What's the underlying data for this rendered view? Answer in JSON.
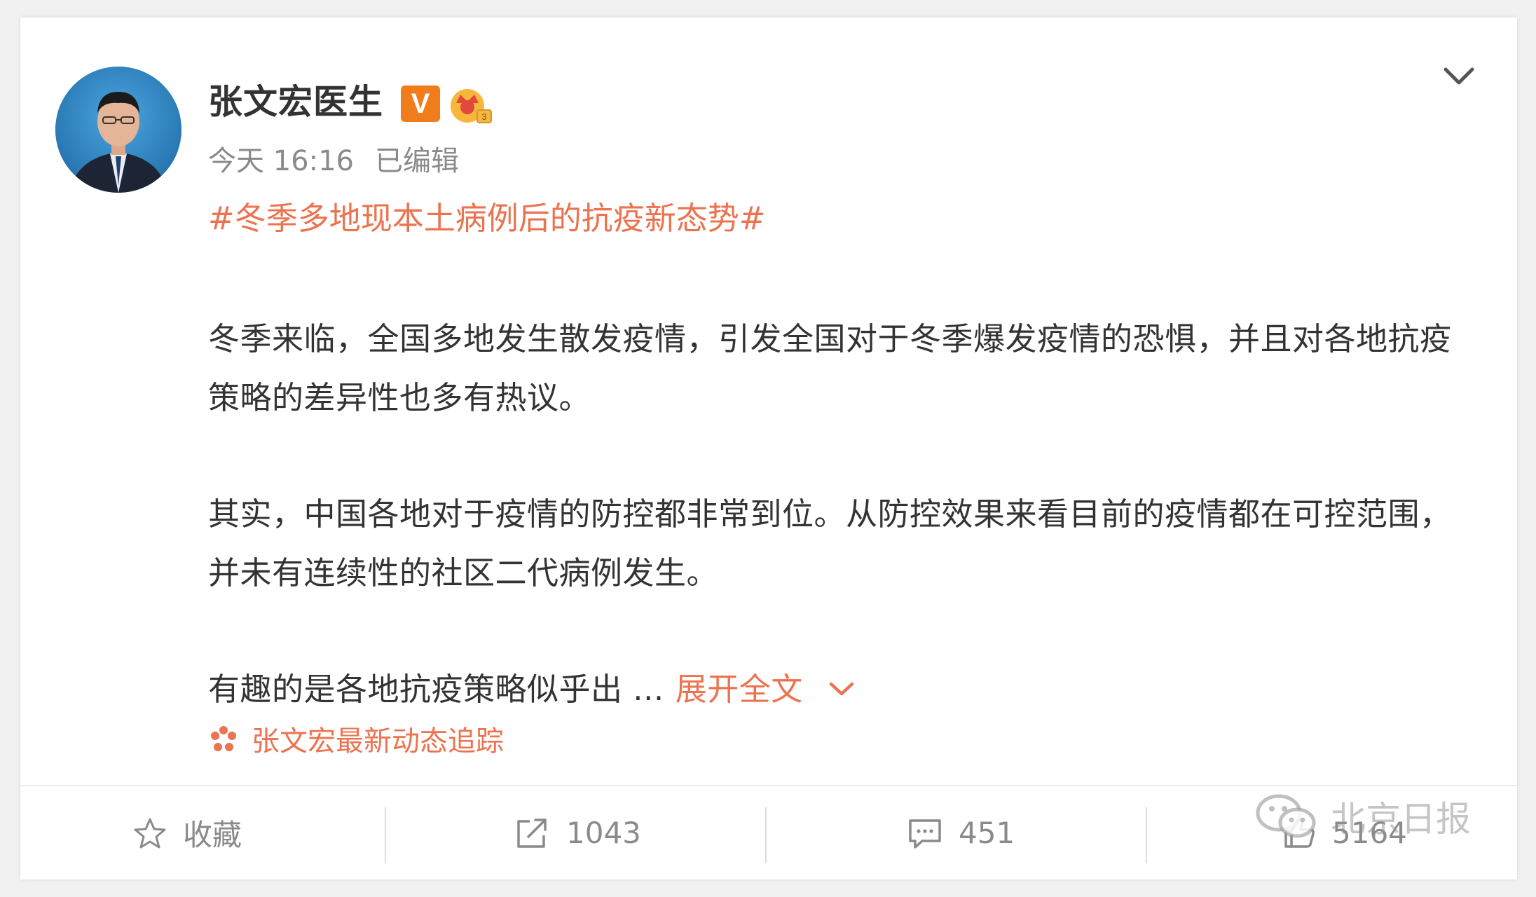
{
  "post": {
    "author": "张文宏医生",
    "verified_badge": "V",
    "time": "今天 16:16",
    "edited": "已编辑",
    "hashtag": "#冬季多地现本土病例后的抗疫新态势#",
    "paragraphs": [
      "冬季来临，全国多地发生散发疫情，引发全国对于冬季爆发疫情的恐惧，并且对各地抗疫策略的差异性也多有热议。",
      "其实，中国各地对于疫情的防控都非常到位。从防控效果来看目前的疫情都在可控范围，并未有连续性的社区二代病例发生。",
      "有趣的是各地抗疫策略似乎出 ..."
    ],
    "expand_label": "展开全文",
    "topic_link": "张文宏最新动态追踪"
  },
  "actions": {
    "favorite": "收藏",
    "repost_count": "1043",
    "comment_count": "451",
    "like_count": "5164"
  },
  "watermark": "北京日报",
  "icons": {
    "more": "chevron-down-icon",
    "vip": "crown-vip-icon",
    "favorite": "star-icon",
    "repost": "share-icon",
    "comment": "comment-icon",
    "like": "thumbs-up-icon",
    "topic": "flower-icon",
    "watermark": "wechat-logo-icon"
  },
  "colors": {
    "accent": "#eb7350",
    "badge_orange": "#f17c1b",
    "text_primary": "#333333",
    "text_secondary": "#8a8a8a"
  }
}
